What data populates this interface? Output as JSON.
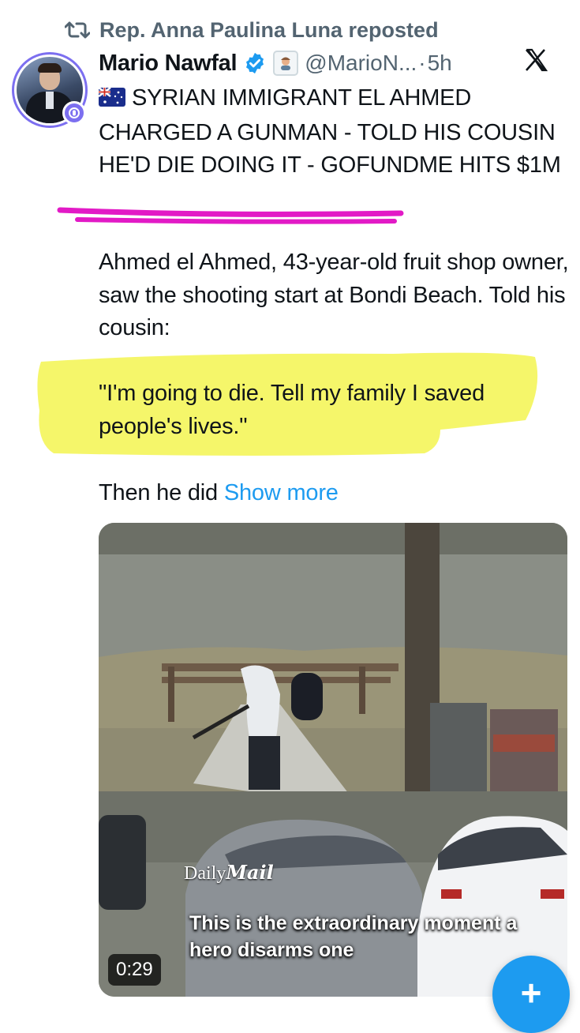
{
  "repost": {
    "icon": "repost-icon",
    "label": "Rep. Anna Paulina Luna reposted"
  },
  "post": {
    "author": {
      "name": "Mario Nawfal",
      "handle": "@MarioN...",
      "time": "5h",
      "verified_color": "#1d9bf0",
      "avatar_ring_color": "#7c6ff0"
    },
    "headline_flag": "australia-flag-icon",
    "headline": "SYRIAN IMMIGRANT EL AHMED CHARGED A GUNMAN - TOLD HIS COUSIN HE'D DIE DOING IT - GOFUNDME HITS $1M",
    "paragraph1": "Ahmed el Ahmed, 43-year-old fruit shop owner, saw the shooting start at Bondi Beach. Told his cousin:",
    "quote": "\"I'm going to die. Tell my family I saved people's lives.\"",
    "paragraph3": "Then he did",
    "show_more": "Show more",
    "annotation_colors": {
      "underline": "#e21ac6",
      "highlight": "#f6f75a"
    }
  },
  "media": {
    "watermark_prefix": "Daily",
    "watermark_brand": "Mail",
    "caption": "This is the extraordinary moment a hero disarms one",
    "duration": "0:29"
  },
  "fab": {
    "label": "+",
    "color": "#1d9bf0"
  }
}
